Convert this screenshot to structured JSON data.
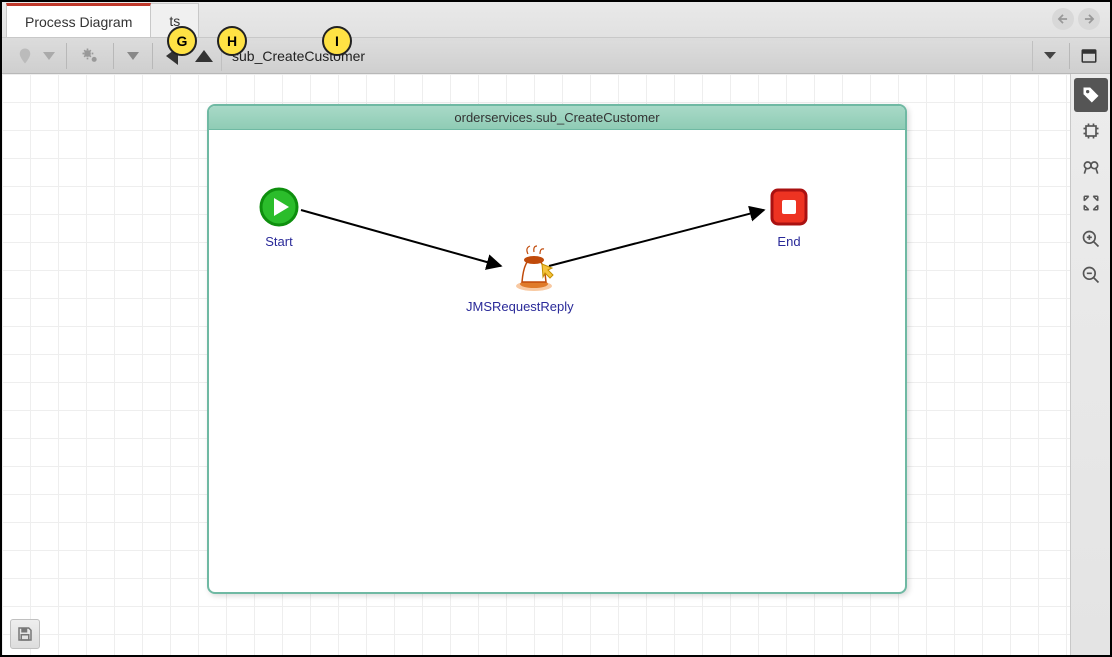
{
  "tabs": {
    "active": "Process Diagram",
    "secondary_partial": "ts"
  },
  "toolbar": {
    "breadcrumb": "sub_CreateCustomer"
  },
  "diagram": {
    "title": "orderservices.sub_CreateCustomer",
    "nodes": {
      "start": "Start",
      "middle": "JMSRequestReply",
      "end": "End"
    }
  },
  "annotations": {
    "g": "G",
    "h": "H",
    "i": "I"
  },
  "side_tools": {
    "window": "window-icon",
    "tag": "tag-icon",
    "chip": "chip-icon",
    "binoculars": "binoculars-icon",
    "collapse": "collapse-icon",
    "zoom_in": "zoom-in-icon",
    "zoom_out": "zoom-out-icon"
  }
}
